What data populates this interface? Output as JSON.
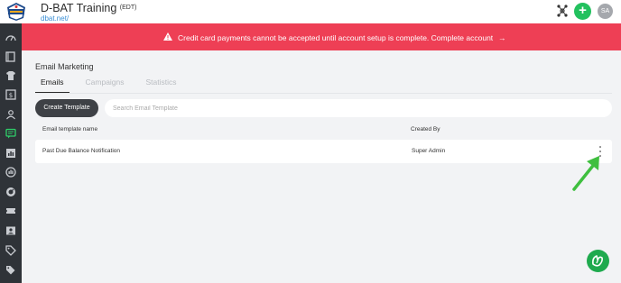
{
  "header": {
    "title": "D-BAT Training",
    "timezone": "(EDT)",
    "subdomain": "dbat.net/",
    "avatar_initials": "SA",
    "add_label": "+"
  },
  "banner": {
    "message": "Credit card payments cannot be accepted until account setup is complete. Complete account",
    "arrow": "→",
    "color": "#ee3f55"
  },
  "sidebar": {
    "items": [
      {
        "icon": "dashboard-icon"
      },
      {
        "icon": "book-icon"
      },
      {
        "icon": "jersey-icon"
      },
      {
        "icon": "dollar-icon"
      },
      {
        "icon": "users-icon"
      },
      {
        "icon": "message-icon",
        "active": true
      },
      {
        "icon": "reports-icon"
      },
      {
        "icon": "stats-icon"
      },
      {
        "icon": "speedometer-icon"
      },
      {
        "icon": "ticket-icon"
      },
      {
        "icon": "id-card-icon"
      },
      {
        "icon": "tag-icon"
      },
      {
        "icon": "tags-icon"
      }
    ]
  },
  "page": {
    "title": "Email Marketing",
    "tabs": [
      {
        "label": "Emails",
        "active": true
      },
      {
        "label": "Campaigns",
        "active": false
      },
      {
        "label": "Statistics",
        "active": false
      }
    ],
    "create_button": "Create Template",
    "search_placeholder": "Search Email Template"
  },
  "table": {
    "columns": [
      "Email template name",
      "Created By"
    ],
    "rows": [
      {
        "name": "Past Due Balance Notification",
        "created_by": "Super Admin"
      }
    ]
  },
  "colors": {
    "accent_green": "#22c15e",
    "sidebar": "#2f3338",
    "annotation_arrow": "#3fbf3f"
  }
}
